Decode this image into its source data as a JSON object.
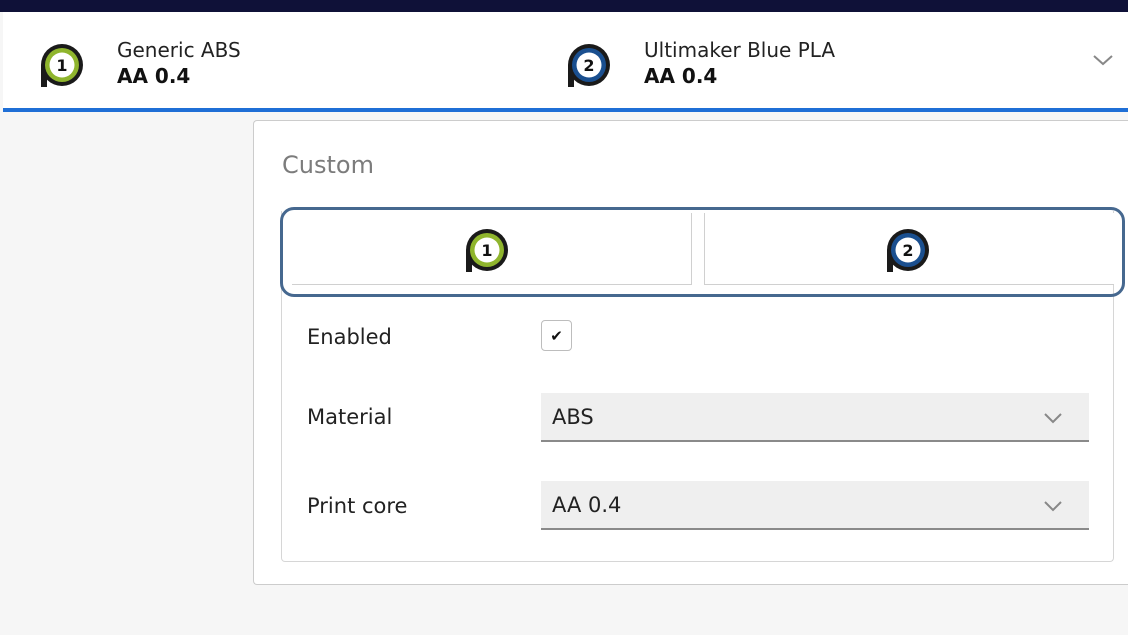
{
  "colors": {
    "topbar": "#0f1138",
    "accent_blue": "#1f6fd6",
    "extruder1_ring": "#8fb52d",
    "extruder2_ring": "#1a4f8f",
    "highlight_outline": "#46688f"
  },
  "header": {
    "extruders": [
      {
        "number": "1",
        "material": "Generic ABS",
        "core": "AA 0.4",
        "icon": "extruder-1-icon"
      },
      {
        "number": "2",
        "material": "Ultimaker Blue PLA",
        "core": "AA 0.4",
        "icon": "extruder-2-icon"
      }
    ],
    "expand_icon": "chevron-down-icon"
  },
  "panel": {
    "title": "Custom",
    "tabs": [
      {
        "number": "1",
        "selected": true
      },
      {
        "number": "2",
        "selected": false
      }
    ],
    "enabled": {
      "label": "Enabled",
      "checked": true,
      "check_glyph": "✔"
    },
    "material": {
      "label": "Material",
      "value": "ABS"
    },
    "print_core": {
      "label": "Print core",
      "value": "AA 0.4"
    }
  }
}
